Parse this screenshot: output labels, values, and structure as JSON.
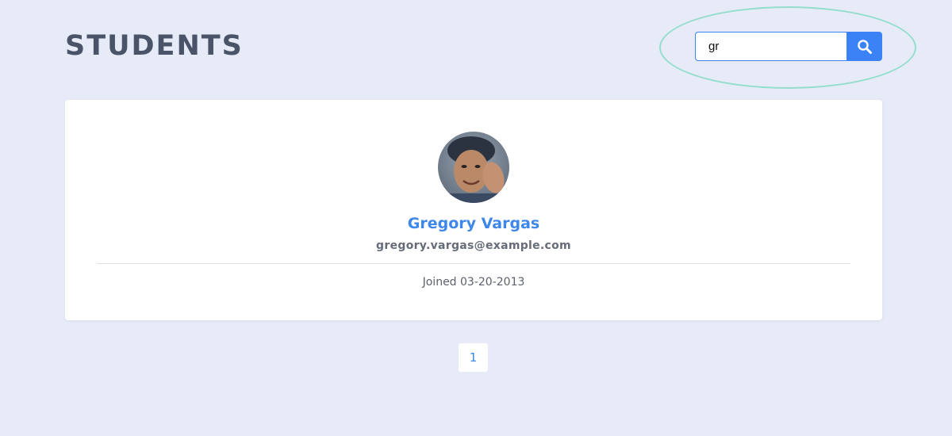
{
  "header": {
    "title": "STUDENTS"
  },
  "search": {
    "value": "gr",
    "icon": "search-icon"
  },
  "student": {
    "name": "Gregory Vargas",
    "email": "gregory.vargas@example.com",
    "joined": "Joined 03-20-2013"
  },
  "pagination": {
    "current_page": "1"
  },
  "colors": {
    "background": "#e6ebf7",
    "accent": "#3b82f6",
    "name": "#3d86ea",
    "highlight": "#92ddcc",
    "title": "#4a5468"
  }
}
